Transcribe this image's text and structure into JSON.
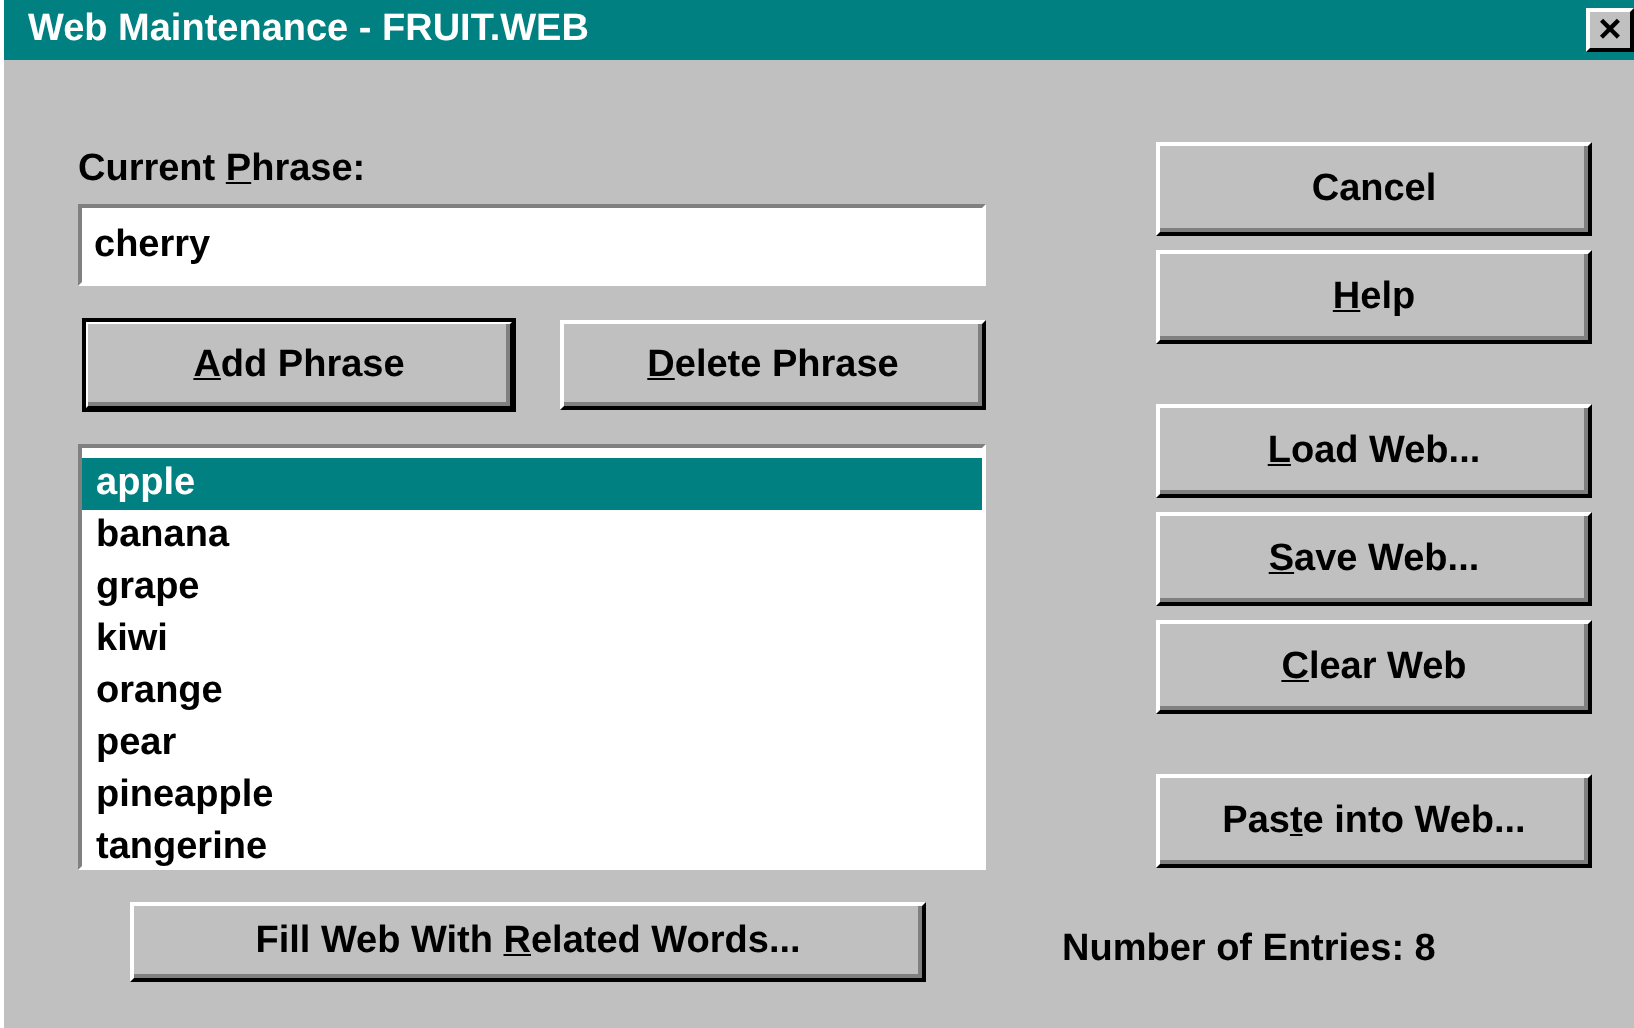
{
  "window": {
    "title": "Web Maintenance - FRUIT.WEB",
    "close": "×"
  },
  "phrase_label": {
    "pre": "Current ",
    "key": "P",
    "post": "hrase:"
  },
  "phrase_field": {
    "value": "cherry"
  },
  "phrase_buttons": [
    {
      "key": "A",
      "post": "dd Phrase",
      "default": true
    },
    {
      "key": "D",
      "post": "elete Phrase",
      "default": false
    }
  ],
  "list": [
    {
      "label": "apple",
      "selected": true
    },
    {
      "label": "banana",
      "selected": false
    },
    {
      "label": "grape",
      "selected": false
    },
    {
      "label": "kiwi",
      "selected": false
    },
    {
      "label": "orange",
      "selected": false
    },
    {
      "label": "pear",
      "selected": false
    },
    {
      "label": "pineapple",
      "selected": false
    },
    {
      "label": "tangerine",
      "selected": false
    }
  ],
  "side_button_groups": [
    [
      {
        "pre": "Cancel"
      },
      {
        "key": "H",
        "post": "elp"
      }
    ],
    [
      {
        "key": "L",
        "post": "oad Web..."
      },
      {
        "key": "S",
        "post": "ave Web..."
      },
      {
        "key": "C",
        "post": "lear Web"
      }
    ],
    [
      {
        "pre": "Pas",
        "key": "t",
        "post": "e into Web..."
      }
    ]
  ],
  "fill_button": {
    "pre": "Fill Web With ",
    "key": "R",
    "post": "elated Words..."
  },
  "entries": "Number of Entries:  8"
}
